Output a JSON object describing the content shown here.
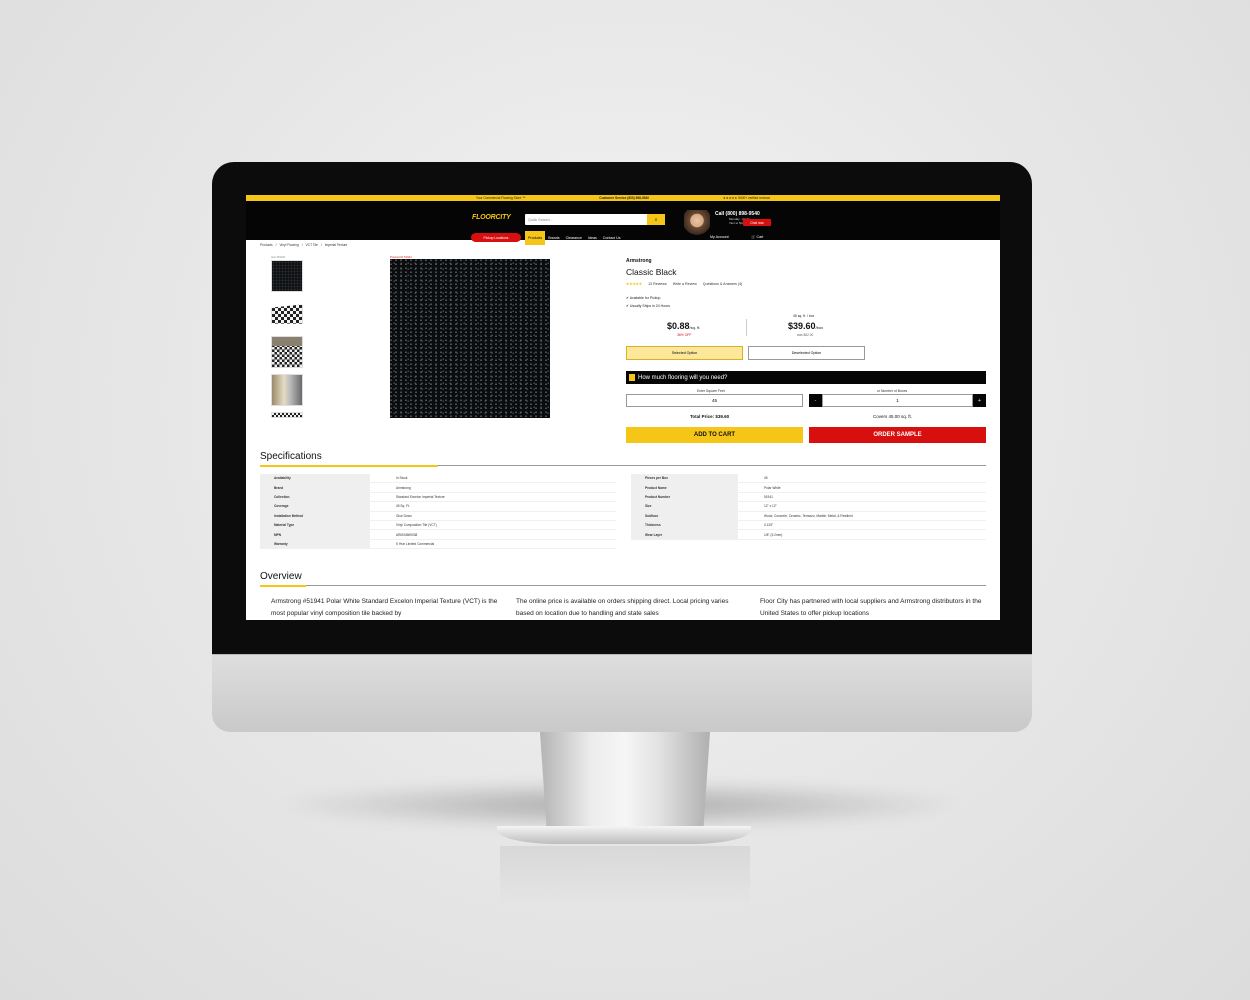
{
  "topbar": {
    "left": "Your Commercial Flooring Store ™",
    "mid": "Customer Service (800) 898-9540",
    "right": "★★★★★ 5000+ verified reviews"
  },
  "header": {
    "logo": "FLOORCITY",
    "search_placeholder": "Quick Search...",
    "call": "Call (800) 898-9540",
    "hours": [
      "Monday - Friday",
      "7am to 5pm PST"
    ],
    "chat": "Chat now",
    "pickup": "Pickup Locations",
    "account": "My Account",
    "cart": "Cart"
  },
  "nav": [
    "Products",
    "Brands",
    "Clearance",
    "Ideas",
    "Contact Us"
  ],
  "breadcrumbs": [
    "Products",
    "/",
    "Vinyl Flooring",
    "/",
    "VCT Tile",
    "/",
    "Imperial Texture"
  ],
  "gallery": {
    "label": "Item #51941",
    "sale_label": "Product ID 51941"
  },
  "product": {
    "brand": "Armstrong",
    "name": "Classic Black",
    "stars": "★★★★★",
    "reviews": "13 Reviews",
    "write": "Write a Review",
    "qa": "Questions & Answers (4)",
    "features": [
      "Available for Pickup",
      "Usually Ships in 24 Hours"
    ],
    "price_sqft": "$0.88",
    "unit_sqft": "/sq. ft.",
    "off": "36% OFF",
    "box_label": "45 sq. ft. / box",
    "price_box": "$39.60",
    "unit_box": "/box",
    "was": "was $62.00",
    "option_selected": "Selected Option",
    "option_deselected": "Deselected Option"
  },
  "calculator": {
    "title": "How much flooring will you need?",
    "sqft_label": "Enter Square Feet",
    "sqft_value": "45",
    "boxes_label": "or Number of Boxes",
    "boxes_value": "1",
    "minus": "-",
    "plus": "+",
    "total": "Total Price: $39.60",
    "covers": "Covers 45.00 sq. ft.",
    "add_to_cart": "ADD TO CART",
    "order_sample": "ORDER SAMPLE"
  },
  "specs": {
    "title": "Specifications",
    "left": [
      [
        "Availability",
        "In Stock"
      ],
      [
        "Brand",
        "Armstrong"
      ],
      [
        "Collection",
        "Standard Excelon Imperial Texture"
      ],
      [
        "Coverage",
        "45 Sq. Ft."
      ],
      [
        "Installation Method",
        "Glue Down"
      ],
      [
        "Material Type",
        "Vinyl Composition Tile (VCT)"
      ],
      [
        "MPN",
        "ARM34569038"
      ],
      [
        "Warranty",
        "5 Year Limited Commercial"
      ]
    ],
    "right": [
      [
        "Pieces per Box",
        "45"
      ],
      [
        "Product Name",
        "Polar White"
      ],
      [
        "Product Number",
        "51941"
      ],
      [
        "Size",
        "12\" x 12\""
      ],
      [
        "Subfloor",
        "Wood, Concrete, Ceramic, Terrazzo, Marble, Metal, & Resilient"
      ],
      [
        "Thickness",
        "0.125\""
      ],
      [
        "Wear Layer",
        "1/8\" (3.2mm)"
      ]
    ]
  },
  "overview": {
    "title": "Overview",
    "cols": [
      "Armstrong #51941 Polar White Standard Excelon Imperial Texture (VCT) is the most popular vinyl composition tile backed by",
      "The online price is available on orders shipping direct. Local pricing varies based on location due to handling and state sales",
      "Floor City has partnered with local suppliers and Armstrong distributors in the United States to offer pickup locations"
    ]
  }
}
